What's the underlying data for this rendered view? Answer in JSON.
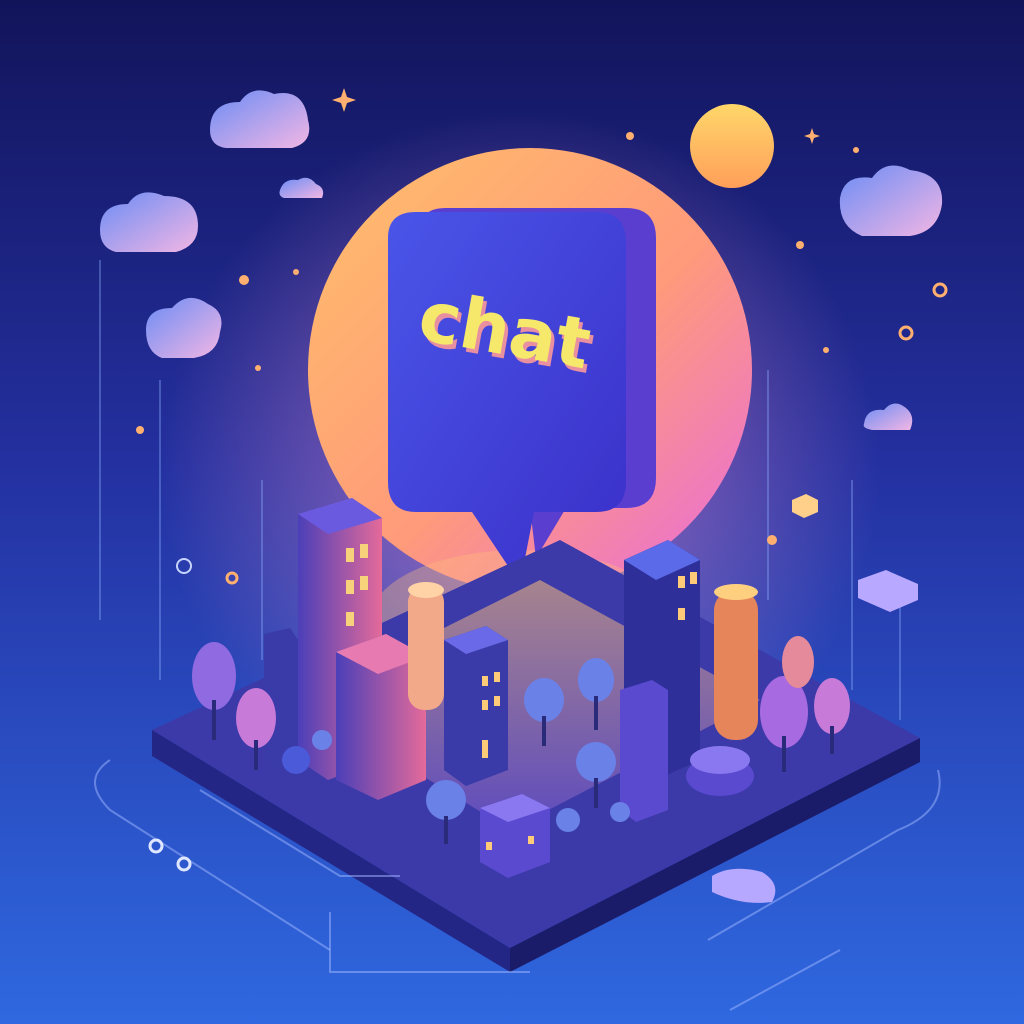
{
  "bubble": {
    "label": "chat"
  },
  "colors": {
    "background_top": "#141860",
    "background_bottom": "#2a5ad8",
    "glow_orange": "#ffb36b",
    "glow_pink": "#e86ad8",
    "bubble_blue": "#3b46d8",
    "bubble_side": "#5a3ed0",
    "text_yellow": "#f6e86a",
    "text_shadow": "#e890a0",
    "sun": "#ffc857",
    "platform_top": "#3a3aa8",
    "platform_side": "#1e207a"
  },
  "icons": {
    "clouds": "cloud-icon",
    "sun": "sun-icon",
    "sparkles": "sparkle-icon",
    "bubble": "speech-bubble-icon"
  }
}
